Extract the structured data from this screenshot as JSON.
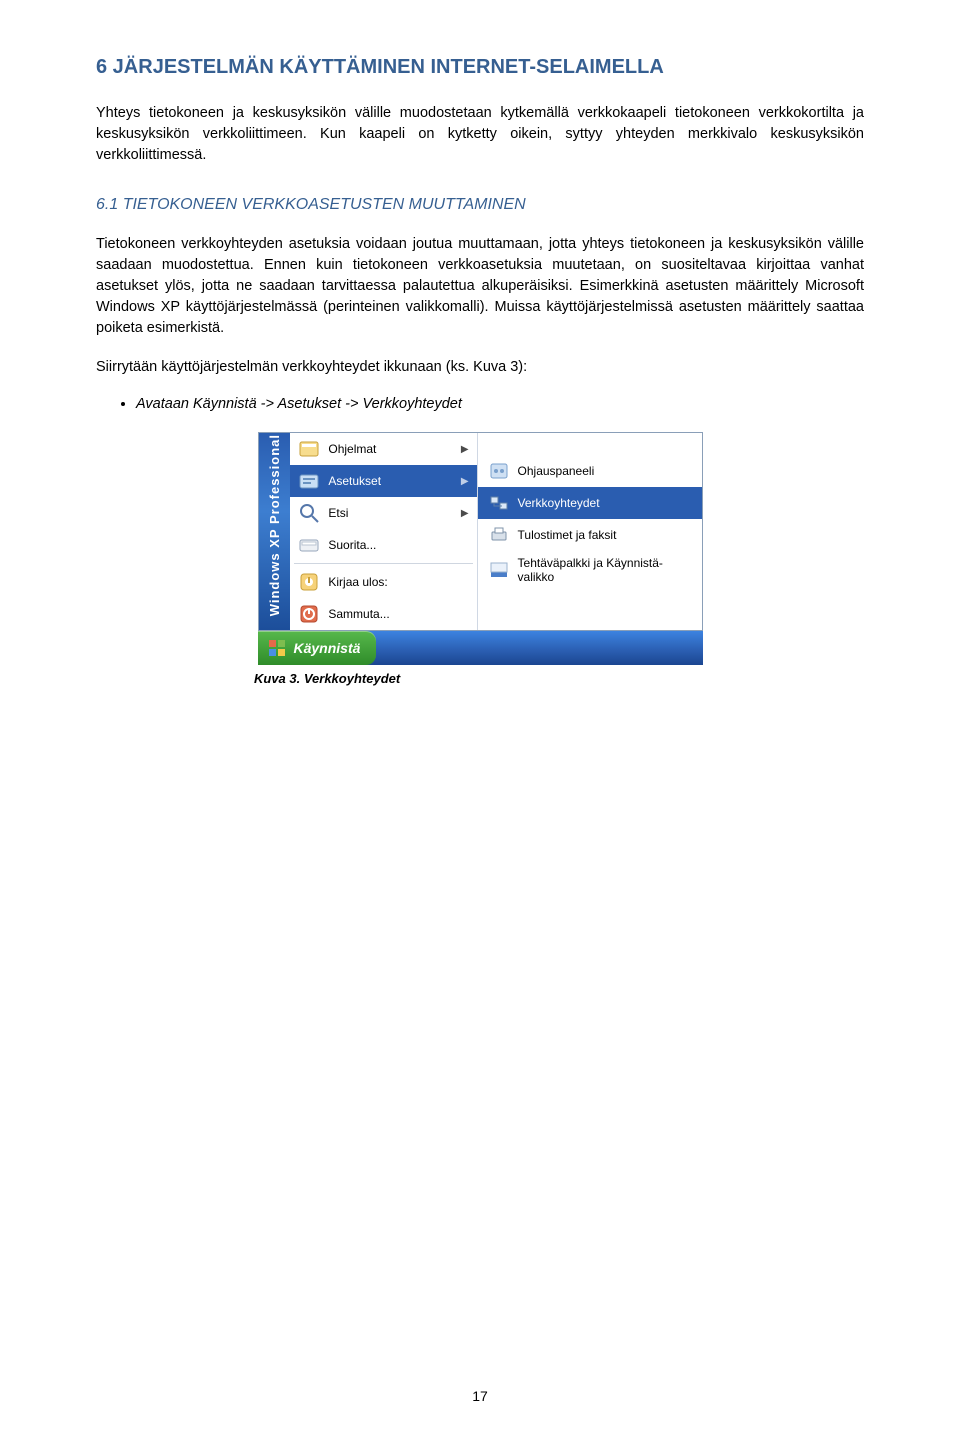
{
  "h1": "6  JÄRJESTELMÄN KÄYTTÄMINEN INTERNET-SELAIMELLA",
  "p1": "Yhteys tietokoneen ja keskusyksikön välille muodostetaan kytkemällä verkkokaapeli tietokoneen verkkokortilta ja keskusyksikön verkkoliittimeen. Kun kaapeli on kytketty oikein, syttyy yhteyden merkkivalo keskusyksikön verkkoliittimessä.",
  "h2": "6.1  TIETOKONEEN VERKKOASETUSTEN MUUTTAMINEN",
  "p2": "Tietokoneen verkkoyhteyden asetuksia voidaan joutua muuttamaan, jotta yhteys tietokoneen ja keskusyksikön välille saadaan muodostettua. Ennen kuin tietokoneen verkkoasetuksia muutetaan, on suositeltavaa kirjoittaa vanhat asetukset ylös, jotta ne saadaan tarvittaessa palautettua alkuperäisiksi. Esimerkkinä asetusten määrittely Microsoft Windows XP käyttöjärjestelmässä (perinteinen valikkomalli). Muissa käyttöjärjestelmissä asetusten määrittely saattaa poiketa esimerkistä.",
  "p3": "Siirrytään käyttöjärjestelmän verkkoyhteydet ikkunaan (ks. Kuva 3):",
  "bullet1": "Avataan Käynnistä -> Asetukset -> Verkkoyhteydet",
  "caption": "Kuva 3. Verkkoyhteydet",
  "pagenum": "17",
  "menu": {
    "sidebar": "Windows XP Professional",
    "left": {
      "ohjelmat": "Ohjelmat",
      "asetukset": "Asetukset",
      "etsi": "Etsi",
      "suorita": "Suorita...",
      "kirjaa": "Kirjaa ulos:",
      "sammuta": "Sammuta..."
    },
    "right": {
      "ohjauspaneeli": "Ohjauspaneeli",
      "verkkoyhteydet": "Verkkoyhteydet",
      "tulostimet": "Tulostimet ja faksit",
      "tehtavapalkki": "Tehtäväpalkki ja Käynnistä-valikko"
    },
    "start": "Käynnistä"
  }
}
